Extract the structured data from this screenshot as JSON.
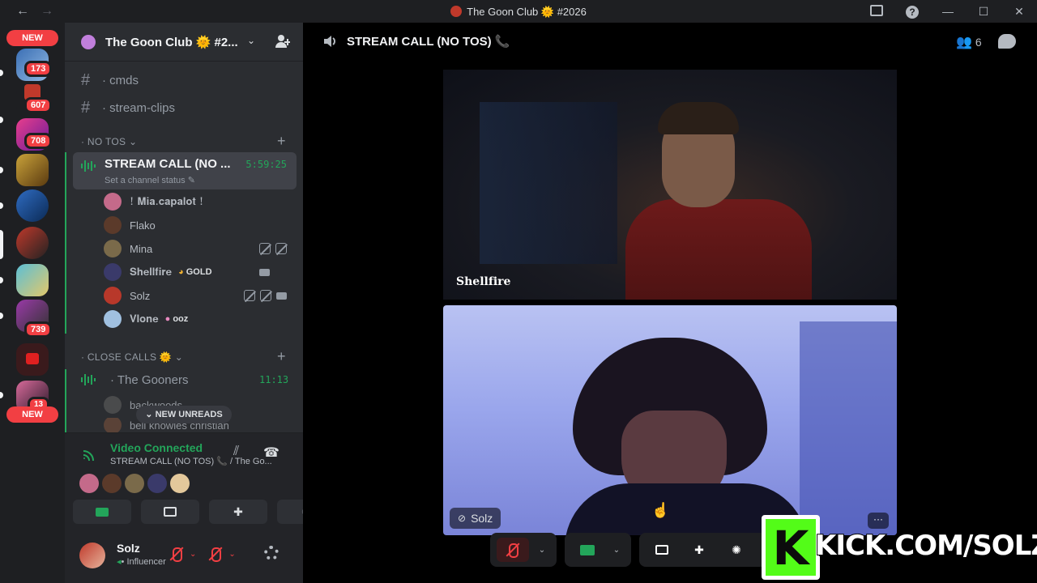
{
  "titlebar": {
    "back": "←",
    "forward": "→",
    "title": "The Goon Club 🌞 #2026"
  },
  "rail": {
    "new_top": "NEW",
    "new_bottom": "NEW",
    "badges": [
      "173",
      "607",
      "708",
      "739",
      "13"
    ]
  },
  "server": {
    "name": "The Goon Club 🌞 #2..."
  },
  "channels": {
    "text": [
      {
        "name": "· cmds"
      },
      {
        "name": "· stream-clips"
      }
    ],
    "cat_no_tos": "· NO TOS",
    "cat_close_calls": "· CLOSE CALLS 🌞",
    "active_voice": {
      "name": "STREAM CALL (NO ...",
      "timer": "5:59:25",
      "status": "Set a channel status ✎"
    },
    "members": [
      {
        "name": "! 𝐌𝐢𝐚.𝐜𝐚𝐩𝐚𝐥𝐨𝐭 !",
        "color": "#c46a8a"
      },
      {
        "name": "Flako",
        "color": "#5b3a2a"
      },
      {
        "name": "Mina",
        "color": "#7a6a4a"
      },
      {
        "name": "𝐒𝐡𝐞𝐥𝐥𝐟𝐢𝐫𝐞",
        "tag": "GOLD",
        "color": "#3a3a6a"
      },
      {
        "name": "Solz",
        "color": "#b8382a"
      },
      {
        "name": "𝐕𝐥𝐨𝐧𝐞",
        "tag": "ooz",
        "color": "#a0c0e0"
      }
    ],
    "second_voice": {
      "name": "· The Gooners",
      "timer": "11:13"
    },
    "second_members": [
      {
        "name": "backwoods"
      },
      {
        "name": "bell knowles christian"
      }
    ],
    "new_unreads": "NEW UNREADS"
  },
  "voice_panel": {
    "title": "Video Connected",
    "subtitle": "STREAM CALL (NO TOS) 📞 / The Go..."
  },
  "user": {
    "name": "Solz",
    "status": "• Influencer"
  },
  "main": {
    "title": "STREAM CALL (NO TOS) 📞",
    "participants": "6",
    "tile1_name": "𝐒𝐡𝐞𝐥𝐥𝐟𝐢𝐫𝐞",
    "tile2_name": "Solz",
    "more": "···"
  },
  "overlay": {
    "logo_letter": "K",
    "url": "KICK.COM/SOLZ"
  }
}
